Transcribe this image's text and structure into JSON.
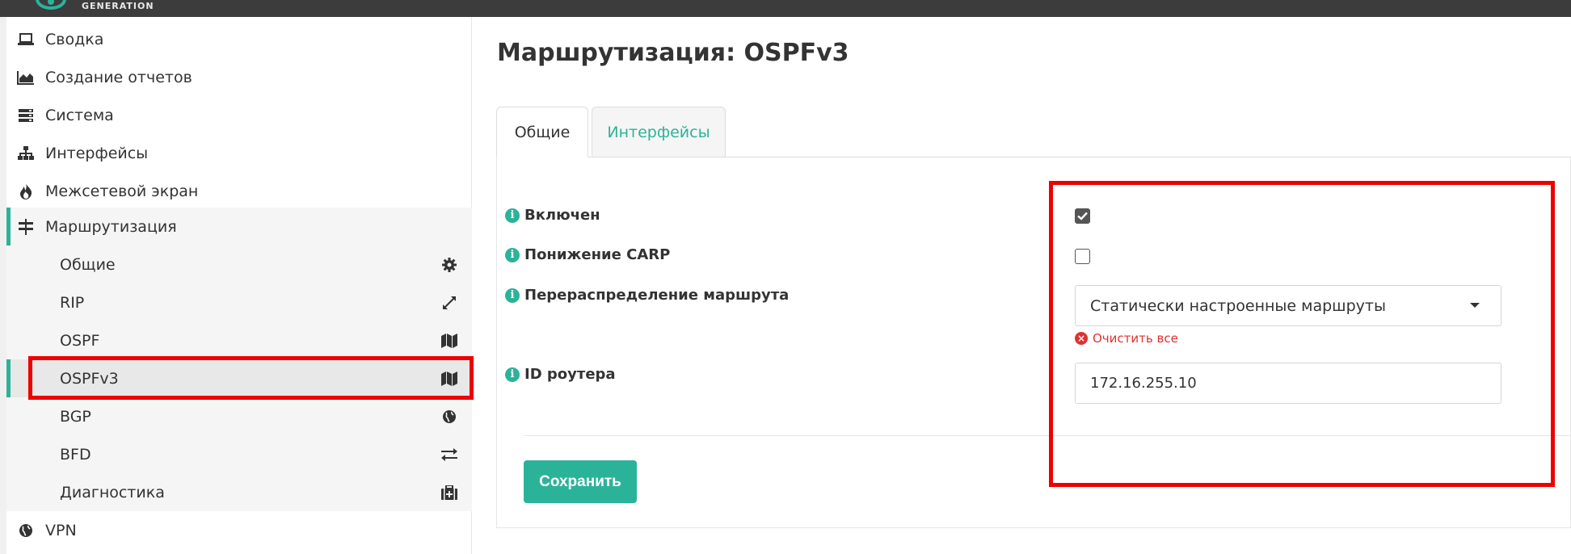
{
  "brand": {
    "logo_text": "GENERATION"
  },
  "sidebar": {
    "items": [
      {
        "label": "Сводка",
        "icon": "laptop-icon"
      },
      {
        "label": "Создание отчетов",
        "icon": "area-chart-icon"
      },
      {
        "label": "Система",
        "icon": "server-icon"
      },
      {
        "label": "Интерфейсы",
        "icon": "sitemap-icon"
      },
      {
        "label": "Межсетевой экран",
        "icon": "fire-icon"
      },
      {
        "label": "Маршрутизация",
        "icon": "signpost-icon"
      }
    ],
    "routing_sub": [
      {
        "label": "Общие",
        "icon": "gear-icon"
      },
      {
        "label": "RIP",
        "icon": "expand-icon"
      },
      {
        "label": "OSPF",
        "icon": "map-icon"
      },
      {
        "label": "OSPFv3",
        "icon": "map-icon"
      },
      {
        "label": "BGP",
        "icon": "globe-icon"
      },
      {
        "label": "BFD",
        "icon": "exchange-icon"
      },
      {
        "label": "Диагностика",
        "icon": "medkit-icon"
      }
    ],
    "vpn": {
      "label": "VPN",
      "icon": "globe-icon"
    }
  },
  "page": {
    "title": "Маршрутизация: OSPFv3"
  },
  "tabs": [
    {
      "label": "Общие",
      "active": true
    },
    {
      "label": "Интерфейсы",
      "active": false
    }
  ],
  "form": {
    "enabled": {
      "label": "Включен",
      "checked": true
    },
    "carp_demote": {
      "label": "Понижение CARP",
      "checked": false
    },
    "redistribute": {
      "label": "Перераспределение маршрута",
      "value": "Статически настроенные маршруты",
      "clear_label": "Очистить все"
    },
    "router_id": {
      "label": "ID роутера",
      "value": "172.16.255.10"
    },
    "save_label": "Сохранить"
  },
  "colors": {
    "accent": "#2bb39a",
    "highlight": "#ee0000",
    "topbar": "#3c3c3c"
  }
}
